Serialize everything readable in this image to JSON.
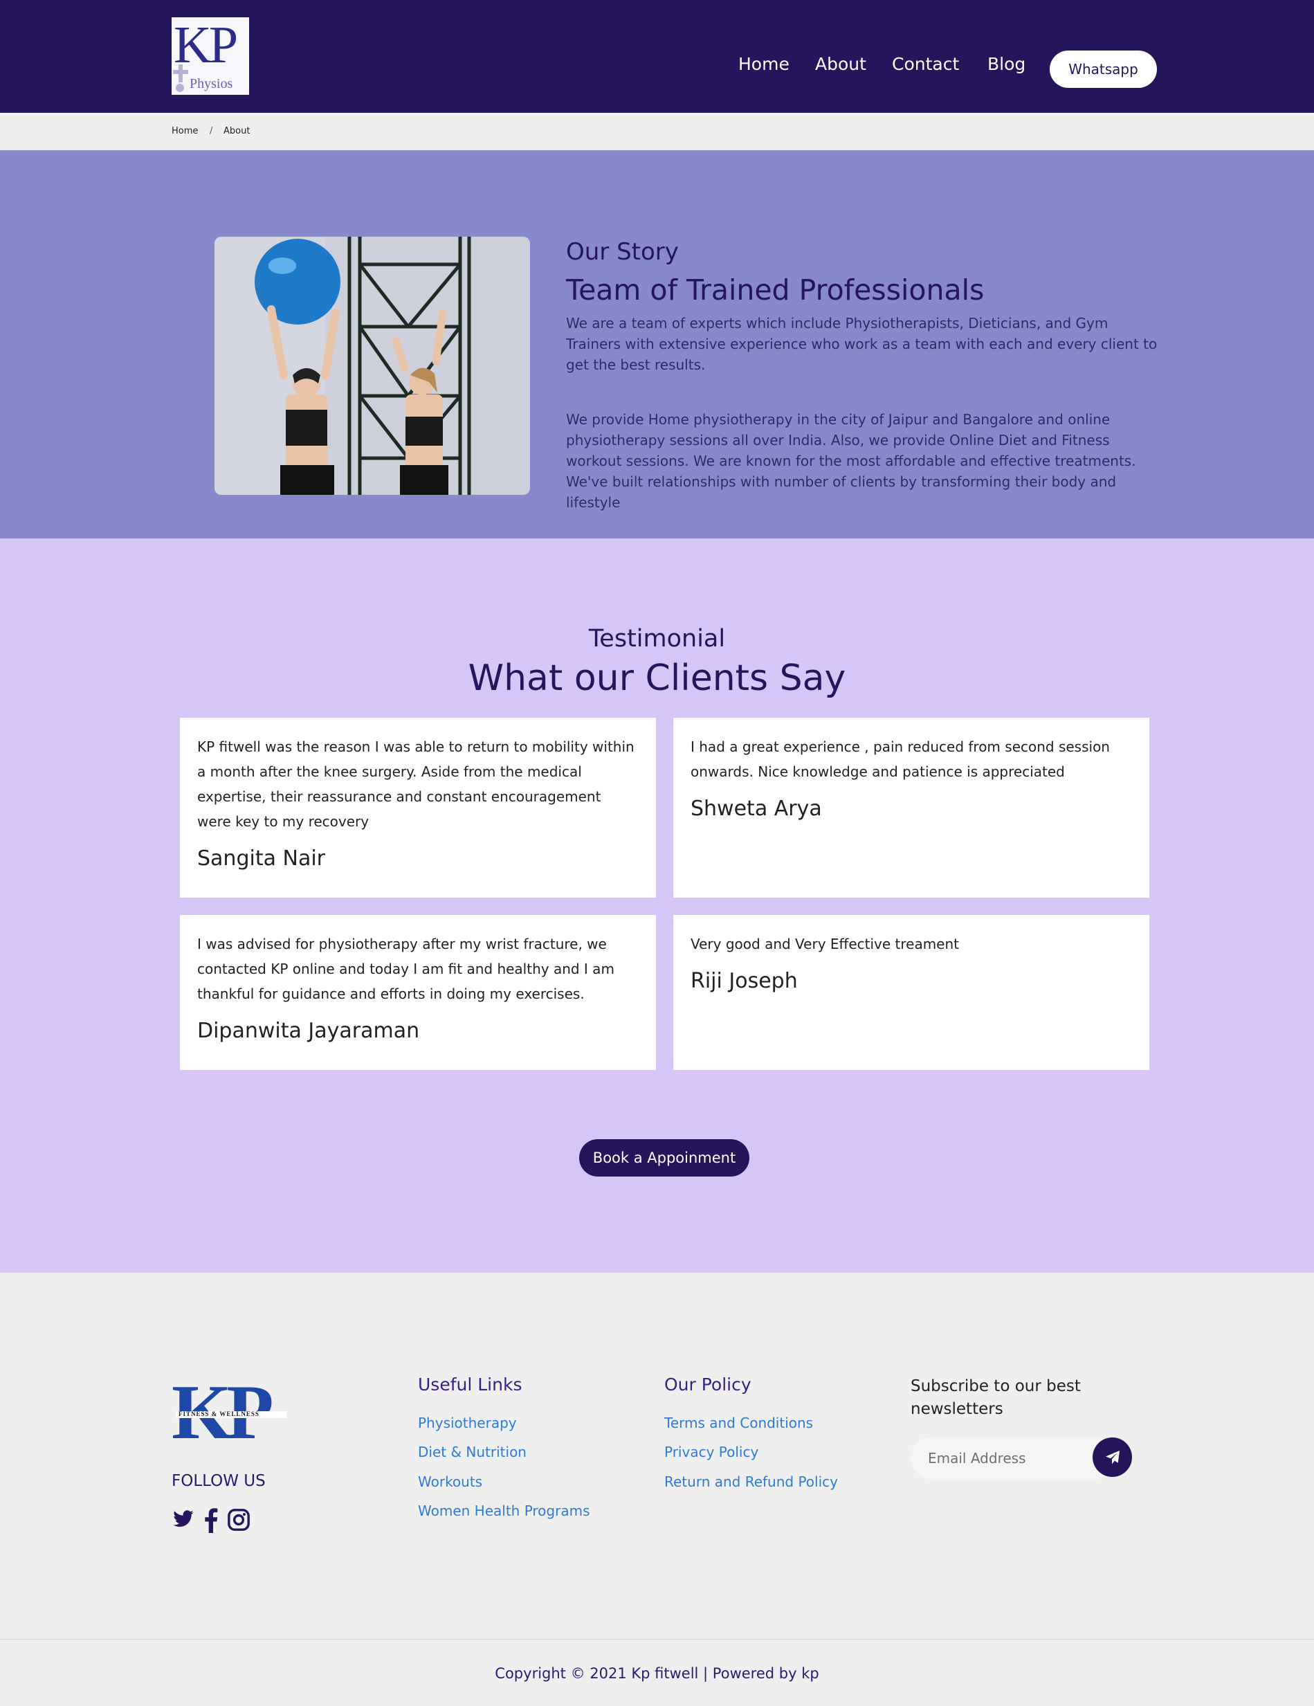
{
  "brand": {
    "logo_text": "KP",
    "logo_sub": "Physios",
    "footer_logo_text": "KP",
    "footer_logo_tagline": "FITNESS & WELLNESS"
  },
  "nav": {
    "items": [
      {
        "label": "Home"
      },
      {
        "label": "About"
      },
      {
        "label": "Contact"
      },
      {
        "label": "Blog"
      }
    ],
    "cta": "Whatsapp"
  },
  "breadcrumb": {
    "items": [
      "Home",
      "About"
    ],
    "separator": "/"
  },
  "story": {
    "kicker": "Our Story",
    "title": "Team of Trained Professionals",
    "paragraph_1": "We are a team of experts which include Physiotherapists, Dieticians, and Gym Trainers with extensive experience who work as a team with each and every client to get the best results.",
    "paragraph_2": "We provide Home physiotherapy in the city of Jaipur and Bangalore and online physiotherapy sessions all over India. Also, we provide Online Diet and Fitness workout sessions. We are known for the most affordable and effective treatments. We've built relationships with number of clients by transforming their body and lifestyle"
  },
  "testimonials": {
    "kicker": "Testimonial",
    "title": "What our Clients Say",
    "items": [
      {
        "text": "KP fitwell was the reason I was able to return to mobility within a month after the knee surgery. Aside from the medical expertise, their reassurance and constant encouragement were key to my recovery",
        "name": "Sangita Nair"
      },
      {
        "text": "I had a great experience , pain reduced from second session onwards. Nice knowledge and patience is appreciated",
        "name": "Shweta Arya"
      },
      {
        "text": "I was advised for physiotherapy after my wrist fracture, we contacted KP online and today I am fit and healthy and I am thankful for guidance and efforts in doing my exercises.",
        "name": "Dipanwita Jayaraman"
      },
      {
        "text": "Very good and Very Effective treament",
        "name": "Riji Joseph"
      }
    ],
    "cta": "Book a Appoinment"
  },
  "footer": {
    "follow": "FOLLOW US",
    "social_icons": [
      "twitter-icon",
      "facebook-icon",
      "instagram-icon"
    ],
    "useful_links": {
      "heading": "Useful Links",
      "items": [
        "Physiotherapy",
        "Diet & Nutrition",
        "Workouts",
        "Women Health Programs"
      ]
    },
    "policy": {
      "heading": "Our Policy",
      "items": [
        "Terms and Conditions",
        "Privacy Policy",
        "Return and Refund Policy"
      ]
    },
    "newsletter": {
      "heading": "Subscribe to our best newsletters",
      "placeholder": "Email Address",
      "send_icon": "paper-plane-icon"
    },
    "copyright": "Copyright © 2021 Kp fitwell | Powered by kp"
  },
  "colors": {
    "header_bg": "#25165c",
    "story_bg": "#8888cc",
    "testimonial_bg": "#d5c6f7",
    "footer_bg": "#efefef",
    "link": "#2f7ad8"
  }
}
